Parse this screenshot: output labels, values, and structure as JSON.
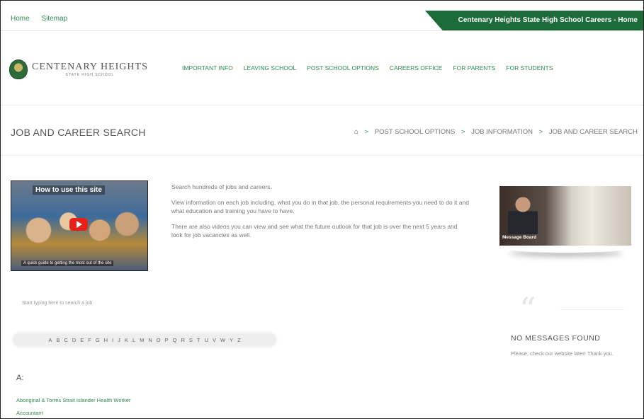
{
  "topbar": {
    "links": [
      "Home",
      "Sitemap"
    ],
    "school_link": "Centenary Heights State High School Careers - Home"
  },
  "header": {
    "logo_line1": "CENTENARY HEIGHTS",
    "logo_line2": "STATE HIGH SCHOOL",
    "nav": [
      "IMPORTANT INFO",
      "LEAVING SCHOOL",
      "POST SCHOOL OPTIONS",
      "CAREERS OFFICE",
      "FOR PARENTS",
      "FOR STUDENTS"
    ]
  },
  "page": {
    "title": "JOB AND CAREER SEARCH",
    "breadcrumb": [
      "POST SCHOOL OPTIONS",
      "JOB INFORMATION",
      "JOB AND CAREER SEARCH"
    ]
  },
  "video": {
    "title": "How to use this site",
    "subtitle": "A quick guide to getting the most out of the site"
  },
  "description": [
    "Search hundreds of jobs and careers.",
    "View information on each job including, what you do in that job, the personal requirements you need to do it and what education and training you have to have.",
    "There are also videos you can view and see what the future outlook for that job is over the next 5 years and look for job vacancies as well."
  ],
  "search": {
    "hint": "Start typing here to search a job"
  },
  "alphabet": [
    "A",
    "B",
    "C",
    "D",
    "E",
    "F",
    "G",
    "H",
    "I",
    "J",
    "K",
    "L",
    "M",
    "N",
    "O",
    "P",
    "Q",
    "R",
    "S",
    "T",
    "U",
    "V",
    "W",
    "Y",
    "Z"
  ],
  "jobs": {
    "section_heading": "A:",
    "items": [
      "Aboriginal & Torres Strait Islander Health Worker",
      "Accountant"
    ]
  },
  "message_board": {
    "image_label": "Message Board",
    "heading": "NO MESSAGES FOUND",
    "subtext": "Please, check our website later! Thank you."
  },
  "colors": {
    "brand_green": "#1c6b39",
    "link_green": "#2f8a4c",
    "play_red": "#e62117"
  }
}
